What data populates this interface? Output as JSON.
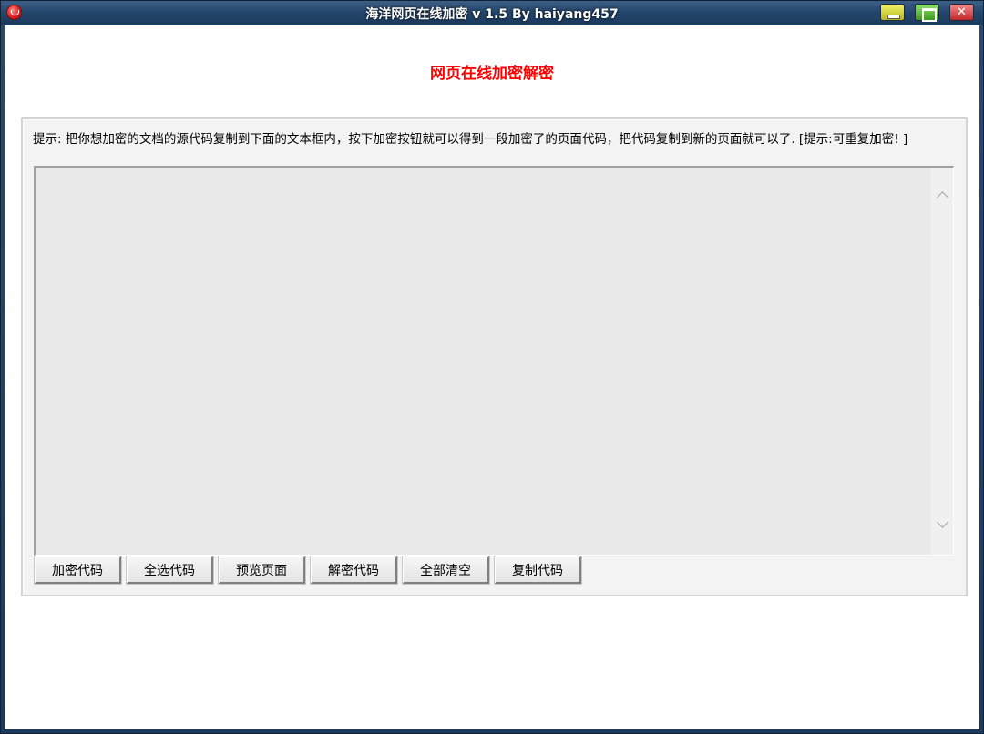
{
  "window": {
    "title": "海洋网页在线加密 v 1.5  By haiyang457"
  },
  "page": {
    "heading": "网页在线加密解密",
    "hint": "提示: 把你想加密的文档的源代码复制到下面的文本框内，按下加密按钮就可以得到一段加密了的页面代码，把代码复制到新的页面就可以了. [提示:可重复加密! ]"
  },
  "editor": {
    "value": ""
  },
  "buttons": [
    {
      "label": "加密代码"
    },
    {
      "label": "全选代码"
    },
    {
      "label": "预览页面"
    },
    {
      "label": "解密代码"
    },
    {
      "label": "全部清空"
    },
    {
      "label": "复制代码"
    }
  ],
  "icons": {
    "app": "app-icon",
    "minimize": "minimize-icon",
    "maximize": "maximize-icon",
    "close": "close-icon",
    "scroll_up": "chevron-up-icon",
    "scroll_down": "chevron-down-icon"
  },
  "colors": {
    "heading": "#ff0000",
    "titlebar": "#24456b",
    "textarea_bg": "#e9e9e9",
    "panel_bg": "#f3f3f3"
  }
}
